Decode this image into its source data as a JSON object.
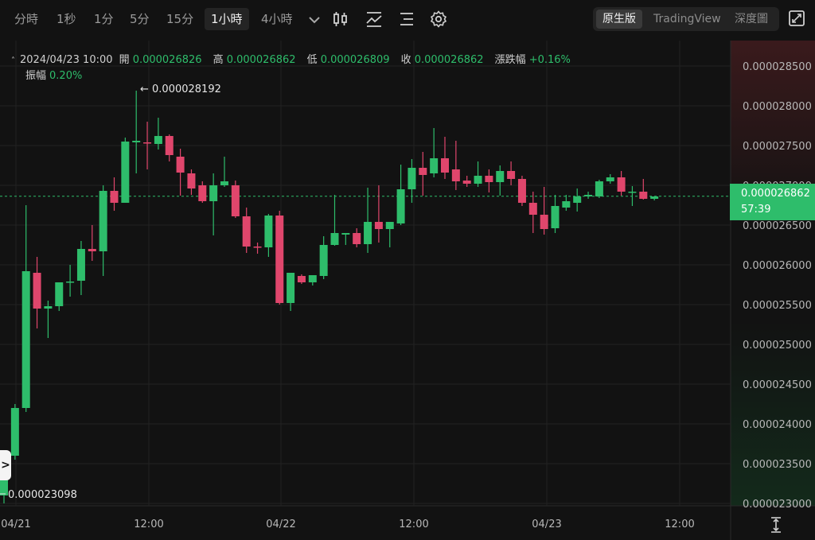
{
  "toolbar": {
    "timeframes": [
      "分時",
      "1秒",
      "1分",
      "5分",
      "15分",
      "1小時",
      "4小時"
    ],
    "active_timeframe": "1小時",
    "views": [
      "原生版",
      "TradingView",
      "深度圖"
    ],
    "active_view": "原生版"
  },
  "legend": {
    "date": "2024/04/23 10:00",
    "open_label": "開",
    "open": "0.000026826",
    "high_label": "高",
    "high": "0.000026862",
    "low_label": "低",
    "low": "0.000026809",
    "close_label": "收",
    "close": "0.000026862",
    "change_label": "漲跌幅",
    "change": "+0.16%",
    "amplitude_label": "振幅",
    "amplitude": "0.20%"
  },
  "colors": {
    "up": "#2ebd6b",
    "down": "#e0466c",
    "background": "#121212",
    "grid": "#222222"
  },
  "price_tag": {
    "price": "0.000026862",
    "countdown": "57:39"
  },
  "annotations": {
    "max": "← 0.000028192",
    "min": "0.000023098"
  },
  "chart_data": {
    "type": "candlestick",
    "y_ticks": [
      "0.000028500",
      "0.000028000",
      "0.000027500",
      "0.000027000",
      "0.000026500",
      "0.000026000",
      "0.000025500",
      "0.000025000",
      "0.000024500",
      "0.000024000",
      "0.000023500",
      "0.000023000"
    ],
    "x_ticks": [
      "04/21",
      "12:00",
      "04/22",
      "12:00",
      "04/23",
      "12:00"
    ],
    "ylim": [
      2.29e-05,
      2.89e-05
    ],
    "last_price": 2.6862e-05,
    "candles": [
      {
        "o": 23.1,
        "h": 23.5,
        "l": 23.0,
        "c": 23.4
      },
      {
        "o": 23.6,
        "h": 24.25,
        "l": 23.55,
        "c": 24.2
      },
      {
        "o": 24.2,
        "h": 26.75,
        "l": 24.15,
        "c": 25.92
      },
      {
        "o": 25.9,
        "h": 26.1,
        "l": 25.2,
        "c": 25.45
      },
      {
        "o": 25.45,
        "h": 25.55,
        "l": 25.08,
        "c": 25.48
      },
      {
        "o": 25.48,
        "h": 25.78,
        "l": 25.42,
        "c": 25.78
      },
      {
        "o": 25.78,
        "h": 26.0,
        "l": 25.6,
        "c": 25.79
      },
      {
        "o": 25.8,
        "h": 26.3,
        "l": 25.62,
        "c": 26.2
      },
      {
        "o": 26.2,
        "h": 26.5,
        "l": 26.05,
        "c": 26.17
      },
      {
        "o": 26.17,
        "h": 27.0,
        "l": 25.86,
        "c": 26.93
      },
      {
        "o": 26.93,
        "h": 27.1,
        "l": 26.68,
        "c": 26.78
      },
      {
        "o": 26.78,
        "h": 27.6,
        "l": 26.78,
        "c": 27.55
      },
      {
        "o": 27.54,
        "h": 28.19,
        "l": 27.15,
        "c": 27.56
      },
      {
        "o": 27.54,
        "h": 27.8,
        "l": 27.2,
        "c": 27.53
      },
      {
        "o": 27.52,
        "h": 27.85,
        "l": 27.45,
        "c": 27.62
      },
      {
        "o": 27.62,
        "h": 27.64,
        "l": 27.3,
        "c": 27.38
      },
      {
        "o": 27.36,
        "h": 27.46,
        "l": 26.87,
        "c": 27.16
      },
      {
        "o": 27.15,
        "h": 27.2,
        "l": 26.88,
        "c": 26.96
      },
      {
        "o": 27.0,
        "h": 27.05,
        "l": 26.78,
        "c": 26.8
      },
      {
        "o": 26.8,
        "h": 27.15,
        "l": 26.37,
        "c": 27.0
      },
      {
        "o": 27.0,
        "h": 27.36,
        "l": 26.98,
        "c": 27.05
      },
      {
        "o": 27.0,
        "h": 27.06,
        "l": 26.59,
        "c": 26.61
      },
      {
        "o": 26.61,
        "h": 26.72,
        "l": 26.15,
        "c": 26.23
      },
      {
        "o": 26.23,
        "h": 26.28,
        "l": 26.14,
        "c": 26.22
      },
      {
        "o": 26.22,
        "h": 26.64,
        "l": 26.1,
        "c": 26.62
      },
      {
        "o": 26.62,
        "h": 26.68,
        "l": 25.5,
        "c": 25.52
      },
      {
        "o": 25.52,
        "h": 25.88,
        "l": 25.42,
        "c": 25.9
      },
      {
        "o": 25.86,
        "h": 25.88,
        "l": 25.76,
        "c": 25.78
      },
      {
        "o": 25.78,
        "h": 25.86,
        "l": 25.74,
        "c": 25.87
      },
      {
        "o": 25.86,
        "h": 26.36,
        "l": 25.82,
        "c": 26.25
      },
      {
        "o": 26.25,
        "h": 26.88,
        "l": 26.24,
        "c": 26.4
      },
      {
        "o": 26.38,
        "h": 26.4,
        "l": 26.25,
        "c": 26.4
      },
      {
        "o": 26.4,
        "h": 26.46,
        "l": 26.22,
        "c": 26.26
      },
      {
        "o": 26.26,
        "h": 26.97,
        "l": 26.15,
        "c": 26.54
      },
      {
        "o": 26.54,
        "h": 27.0,
        "l": 26.28,
        "c": 26.45
      },
      {
        "o": 26.45,
        "h": 26.54,
        "l": 26.22,
        "c": 26.54
      },
      {
        "o": 26.52,
        "h": 27.26,
        "l": 26.5,
        "c": 26.95
      },
      {
        "o": 26.95,
        "h": 27.33,
        "l": 26.78,
        "c": 27.22
      },
      {
        "o": 27.22,
        "h": 27.42,
        "l": 26.87,
        "c": 27.13
      },
      {
        "o": 27.15,
        "h": 27.72,
        "l": 27.1,
        "c": 27.34
      },
      {
        "o": 27.34,
        "h": 27.61,
        "l": 27.08,
        "c": 27.16
      },
      {
        "o": 27.2,
        "h": 27.56,
        "l": 26.94,
        "c": 27.05
      },
      {
        "o": 27.06,
        "h": 27.12,
        "l": 26.98,
        "c": 27.02
      },
      {
        "o": 27.02,
        "h": 27.3,
        "l": 26.98,
        "c": 27.12
      },
      {
        "o": 27.12,
        "h": 27.2,
        "l": 26.91,
        "c": 27.04
      },
      {
        "o": 27.04,
        "h": 27.25,
        "l": 26.87,
        "c": 27.18
      },
      {
        "o": 27.18,
        "h": 27.3,
        "l": 27.0,
        "c": 27.08
      },
      {
        "o": 27.08,
        "h": 27.12,
        "l": 26.74,
        "c": 26.78
      },
      {
        "o": 26.78,
        "h": 26.92,
        "l": 26.4,
        "c": 26.63
      },
      {
        "o": 26.63,
        "h": 26.98,
        "l": 26.38,
        "c": 26.45
      },
      {
        "o": 26.46,
        "h": 26.88,
        "l": 26.4,
        "c": 26.74
      },
      {
        "o": 26.72,
        "h": 26.88,
        "l": 26.68,
        "c": 26.8
      },
      {
        "o": 26.78,
        "h": 26.96,
        "l": 26.67,
        "c": 26.86
      },
      {
        "o": 26.86,
        "h": 26.92,
        "l": 26.83,
        "c": 26.88
      },
      {
        "o": 26.86,
        "h": 27.07,
        "l": 26.84,
        "c": 27.05
      },
      {
        "o": 27.05,
        "h": 27.14,
        "l": 27.02,
        "c": 27.1
      },
      {
        "o": 27.1,
        "h": 27.18,
        "l": 26.87,
        "c": 26.92
      },
      {
        "o": 26.92,
        "h": 26.99,
        "l": 26.74,
        "c": 26.92
      },
      {
        "o": 26.92,
        "h": 27.08,
        "l": 26.82,
        "c": 26.83
      },
      {
        "o": 26.83,
        "h": 26.86,
        "l": 26.81,
        "c": 26.86
      }
    ]
  }
}
